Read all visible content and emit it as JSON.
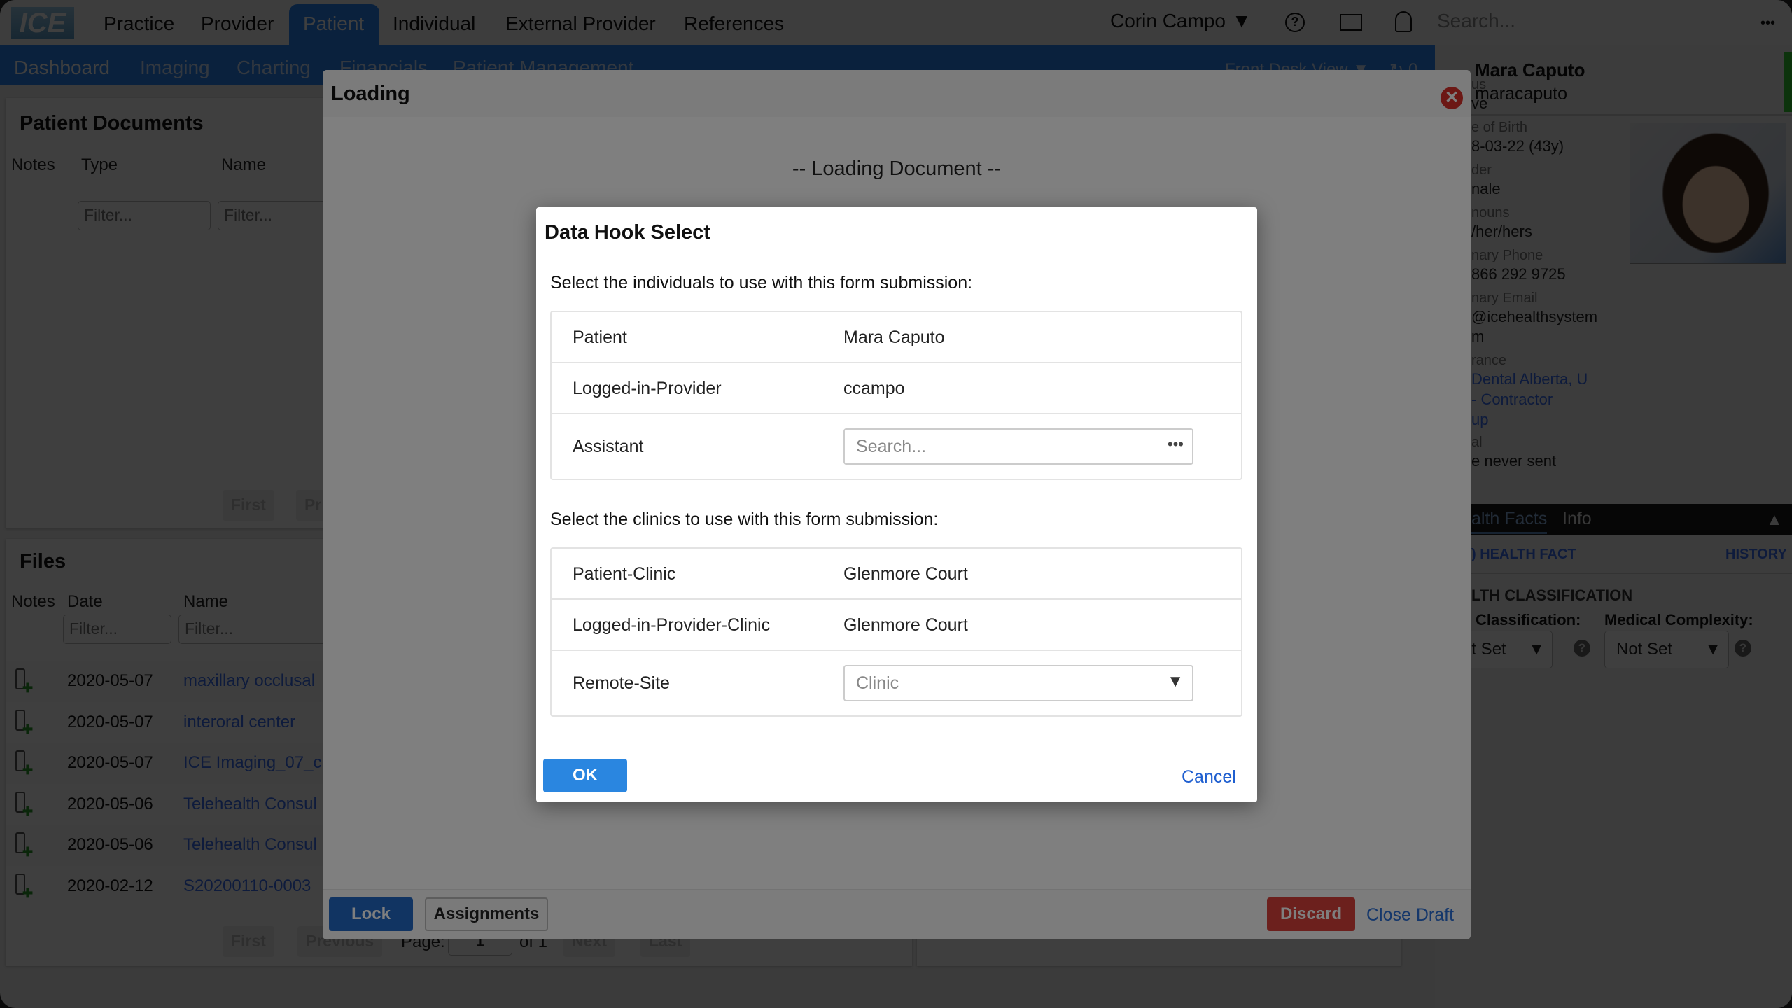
{
  "topnav": {
    "logo": "ICE",
    "items": [
      "Practice",
      "Provider",
      "Patient",
      "Individual",
      "External Provider",
      "References"
    ],
    "active": "Patient",
    "user": "Corin Campo",
    "search_placeholder": "Search...",
    "more": "•••"
  },
  "subnav": {
    "items": [
      "Dashboard",
      "Imaging",
      "Charting",
      "Financials",
      "Patient Management"
    ],
    "view": "Front Desk View ▼",
    "refresh_count": "0"
  },
  "patient_documents": {
    "title": "Patient Documents",
    "columns": [
      "Notes",
      "Type",
      "Name"
    ],
    "filter_placeholder": "Filter...",
    "first": "First",
    "previous": "Pr"
  },
  "files": {
    "title": "Files",
    "columns": [
      "Notes",
      "Date",
      "Name"
    ],
    "filter_placeholder": "Filter...",
    "rows": [
      {
        "date": "2020-05-07",
        "name": "maxillary occlusal"
      },
      {
        "date": "2020-05-07",
        "name": "interoral center"
      },
      {
        "date": "2020-05-07",
        "name": "ICE Imaging_07_cr"
      },
      {
        "date": "2020-05-06",
        "name": "Telehealth Consul"
      },
      {
        "date": "2020-05-06",
        "name": "Telehealth Consul"
      },
      {
        "date": "2020-02-12",
        "name": "S20200110-0003"
      }
    ],
    "pagination": {
      "first": "First",
      "previous": "Previous",
      "page_label": "Page:",
      "page": "1",
      "of": "of 1",
      "next": "Next",
      "last": "Last"
    }
  },
  "sidebar": {
    "name": "Mara Caputo",
    "username": "maracaputo",
    "fields": [
      {
        "label": "us",
        "value": "ve"
      },
      {
        "label": "e of Birth",
        "value": "8-03-22 (43y)"
      },
      {
        "label": "der",
        "value": "nale"
      },
      {
        "label": "nouns",
        "value": "/her/hers"
      },
      {
        "label": "nary Phone",
        "value": "866 292 9725"
      },
      {
        "label": "nary Email",
        "value": "@icehealthsystem",
        "value2": "m"
      }
    ],
    "insurance_label": "rance",
    "insurance": [
      "Dental Alberta, U",
      "- Contractor",
      "up"
    ],
    "al_label": "al",
    "al_value": "e never sent",
    "tabs": [
      "alth Facts",
      "Info"
    ],
    "add_health_fact": ") HEALTH FACT",
    "history": "HISTORY",
    "classification_title": "LTH CLASSIFICATION",
    "classification_label": "Classification:",
    "classification_value": "ot Set",
    "complexity_label": "Medical Complexity:",
    "complexity_value": "Not Set",
    "status_color": "#33cc33"
  },
  "loading": {
    "title": "Loading",
    "message": "-- Loading Document --",
    "lock": "Lock",
    "assignments": "Assignments",
    "discard": "Discard",
    "close_draft": "Close Draft"
  },
  "dialog": {
    "title": "Data Hook Select",
    "individuals_prompt": "Select the individuals to use with this form submission:",
    "individuals": [
      {
        "label": "Patient",
        "value": "Mara Caputo"
      },
      {
        "label": "Logged-in-Provider",
        "value": "ccampo"
      },
      {
        "label": "Assistant",
        "placeholder": "Search..."
      }
    ],
    "clinics_prompt": "Select the clinics to use with this form submission:",
    "clinics": [
      {
        "label": "Patient-Clinic",
        "value": "Glenmore Court"
      },
      {
        "label": "Logged-in-Provider-Clinic",
        "value": "Glenmore Court"
      },
      {
        "label": "Remote-Site",
        "placeholder": "Clinic"
      }
    ],
    "ok": "OK",
    "cancel": "Cancel"
  },
  "colors": {
    "primary": "#2a86e0",
    "danger": "#d9413a",
    "link": "#1f5fd0"
  }
}
